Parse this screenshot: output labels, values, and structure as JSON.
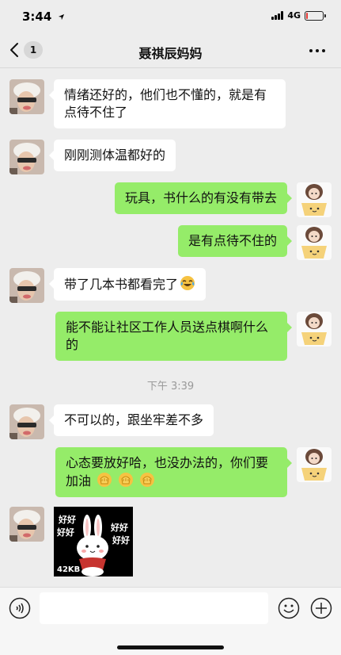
{
  "status_bar": {
    "time": "3:44",
    "network": "4G",
    "battery_level": 0.12,
    "battery_color": "#e53935"
  },
  "nav": {
    "back_icon": "chevron-left-icon",
    "unread_count": "1",
    "title": "聂祺辰妈妈",
    "more_icon": "more-dots-icon"
  },
  "colors": {
    "incoming_bubble": "#ffffff",
    "outgoing_bubble": "#95ec69",
    "background": "#ededed"
  },
  "messages": [
    {
      "side": "left",
      "text": "情绪还好的，他们也不懂的，就是有点待不住了"
    },
    {
      "side": "left",
      "text": "刚刚测体温都好的"
    },
    {
      "side": "right",
      "text": "玩具，书什么的有没有带去"
    },
    {
      "side": "right",
      "text": "是有点待不住的"
    },
    {
      "side": "left",
      "text": "带了几本书都看完了",
      "emoji": "laugh-cry-emoji"
    },
    {
      "side": "right",
      "text": "能不能让社区工作人员送点棋啊什么的"
    },
    {
      "side": "time",
      "text": "下午 3:39"
    },
    {
      "side": "left",
      "text": "不可以的，跟坐牢差不多"
    },
    {
      "side": "right",
      "text": "心态要放好哈，也没办法的，你们要加油",
      "emoji": "fist-emoji x3"
    },
    {
      "side": "left",
      "type": "sticker",
      "sticker_text": [
        "好好",
        "好好",
        "好好",
        "好好"
      ],
      "size_label": "42KB",
      "sticker_icon": "rabbit-sticker"
    }
  ],
  "input_bar": {
    "voice_icon": "voice-icon",
    "emoji_icon": "emoji-icon",
    "plus_icon": "plus-icon",
    "placeholder": ""
  }
}
